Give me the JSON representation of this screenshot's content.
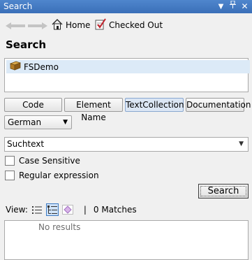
{
  "panel": {
    "title": "Search"
  },
  "nav": {
    "home_label": "Home",
    "checked_out_label": "Checked Out"
  },
  "heading": "Search",
  "list": {
    "items": [
      {
        "label": "FSDemo"
      }
    ]
  },
  "tabs": [
    {
      "label": "Code"
    },
    {
      "label": "Element Name"
    },
    {
      "label": "TextCollection",
      "active": true
    },
    {
      "label": "Documentation"
    }
  ],
  "language": {
    "selected": "German"
  },
  "query": {
    "value": "Suchtext"
  },
  "options": {
    "case_sensitive_label": "Case Sensitive",
    "case_sensitive_checked": false,
    "regex_label": "Regular expression",
    "regex_checked": false
  },
  "search_button_label": "Search",
  "view": {
    "label": "View:",
    "matches": "0 Matches",
    "separator": "|"
  },
  "results": {
    "empty_text": "No results"
  },
  "colors": {
    "titlebar": "#3a6fb8",
    "selection": "#dceaf7"
  }
}
